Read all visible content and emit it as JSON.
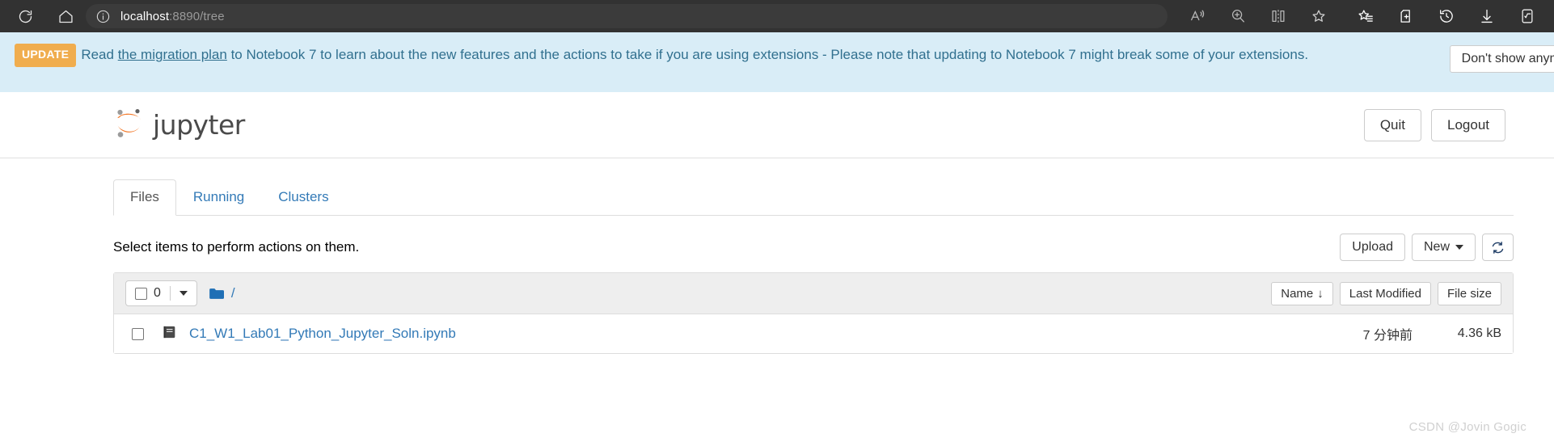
{
  "browser": {
    "url_host": "localhost",
    "url_rest": ":8890/tree",
    "left_icons": [
      {
        "name": "reload-icon",
        "glyph": "reload"
      },
      {
        "name": "home-icon",
        "glyph": "home"
      }
    ],
    "address_info_icon": "info-icon",
    "inline_icons": [
      {
        "name": "read-aloud-icon",
        "glyph": "read-aloud"
      },
      {
        "name": "zoom-icon",
        "glyph": "zoom"
      },
      {
        "name": "split-screen-icon",
        "glyph": "split"
      },
      {
        "name": "favorite-star-icon",
        "glyph": "star"
      }
    ],
    "right_icons": [
      {
        "name": "favorites-list-icon",
        "glyph": "star-list"
      },
      {
        "name": "collections-icon",
        "glyph": "collections"
      },
      {
        "name": "history-icon",
        "glyph": "history"
      },
      {
        "name": "downloads-icon",
        "glyph": "download"
      },
      {
        "name": "math-solver-icon",
        "glyph": "math"
      }
    ]
  },
  "banner": {
    "badge": "UPDATE",
    "text_before_link": "Read ",
    "link_text": "the migration plan",
    "text_after_link": " to Notebook 7 to learn about the new features and the actions to take if you are using extensions - Please note that updating to Notebook 7 might break some of your extensions.",
    "dismiss_label": "Don't show anymore",
    "bg_color": "#d9edf7",
    "badge_color": "#f0ad4e",
    "text_color": "#31708f"
  },
  "header": {
    "logo_text": "jupyter",
    "logo_color": "#f37726",
    "quit_label": "Quit",
    "logout_label": "Logout"
  },
  "tabs": [
    {
      "label": "Files",
      "active": true
    },
    {
      "label": "Running",
      "active": false
    },
    {
      "label": "Clusters",
      "active": false
    }
  ],
  "toolbar": {
    "select_hint": "Select items to perform actions on them.",
    "upload_label": "Upload",
    "new_label": "New",
    "refresh_icon": "refresh-icon"
  },
  "filelist": {
    "selected_count": "0",
    "breadcrumb_root": "/",
    "columns": [
      {
        "label": "Name",
        "sort": "↓"
      },
      {
        "label": "Last Modified",
        "sort": ""
      },
      {
        "label": "File size",
        "sort": ""
      }
    ],
    "rows": [
      {
        "icon": "notebook-icon",
        "name": "C1_W1_Lab01_Python_Jupyter_Soln.ipynb",
        "modified": "7 分钟前",
        "size": "4.36 kB"
      }
    ]
  },
  "watermark": "CSDN @Jovin Gogic"
}
